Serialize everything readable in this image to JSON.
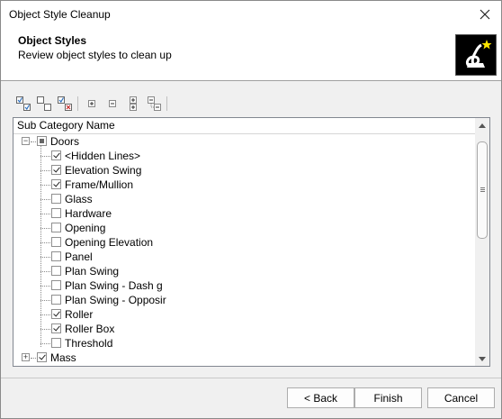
{
  "window": {
    "title": "Object Style Cleanup"
  },
  "header": {
    "title": "Object Styles",
    "subtitle": "Review object styles to clean up"
  },
  "tree": {
    "column_header": "Sub Category Name",
    "nodes": [
      {
        "label": "Doors",
        "level": 0,
        "expander": "−",
        "check": "partial"
      },
      {
        "label": "<Hidden Lines>",
        "level": 1,
        "check": "checked"
      },
      {
        "label": "Elevation Swing",
        "level": 1,
        "check": "checked"
      },
      {
        "label": "Frame/Mullion",
        "level": 1,
        "check": "checked"
      },
      {
        "label": "Glass",
        "level": 1,
        "check": "unchecked"
      },
      {
        "label": "Hardware",
        "level": 1,
        "check": "unchecked"
      },
      {
        "label": "Opening",
        "level": 1,
        "check": "unchecked"
      },
      {
        "label": "Opening Elevation",
        "level": 1,
        "check": "unchecked"
      },
      {
        "label": "Panel",
        "level": 1,
        "check": "unchecked"
      },
      {
        "label": "Plan Swing",
        "level": 1,
        "check": "unchecked"
      },
      {
        "label": "Plan Swing - Dash   g",
        "level": 1,
        "check": "unchecked"
      },
      {
        "label": "Plan Swing - Opposir",
        "level": 1,
        "check": "unchecked"
      },
      {
        "label": "Roller",
        "level": 1,
        "check": "checked"
      },
      {
        "label": "Roller Box",
        "level": 1,
        "check": "checked"
      },
      {
        "label": "Threshold",
        "level": 1,
        "check": "unchecked"
      },
      {
        "label": "Mass",
        "level": 0,
        "expander": "+",
        "check": "checked"
      }
    ]
  },
  "toolbar": {
    "buttons": [
      "check-all-icon",
      "uncheck-all-icon",
      "invert-check-icon",
      "expand-icon",
      "collapse-icon",
      "expand-all-icon",
      "collapse-all-icon"
    ]
  },
  "footer": {
    "back": "< Back",
    "finish": "Finish",
    "cancel": "Cancel"
  },
  "colors": {
    "border": "#828790",
    "header_bg": "#ffffff",
    "dialog_bg": "#f0f0f0"
  }
}
